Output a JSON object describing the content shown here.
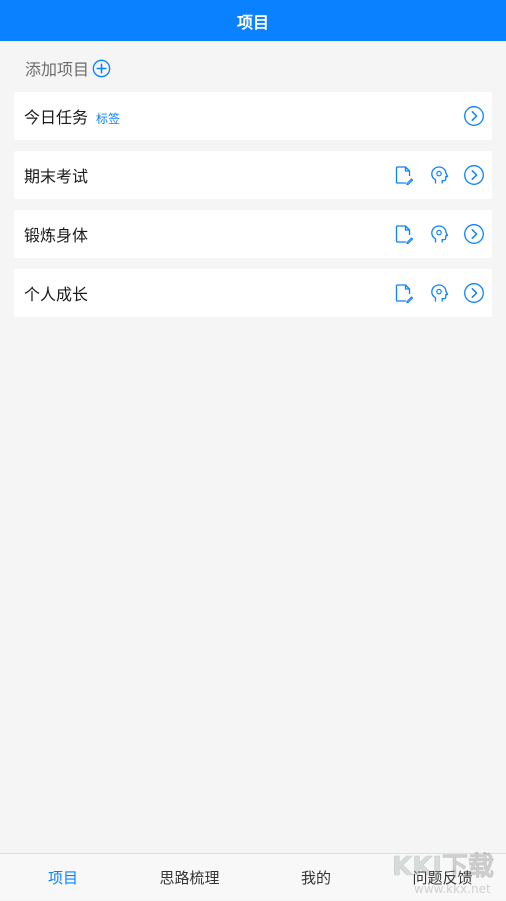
{
  "header": {
    "title": "项目"
  },
  "add_project": {
    "label": "添加项目",
    "icon": "plus-circle-icon"
  },
  "projects": [
    {
      "name": "今日任务",
      "tag": "标签",
      "has_actions": false
    },
    {
      "name": "期末考试",
      "has_actions": true
    },
    {
      "name": "锻炼身体",
      "has_actions": true
    },
    {
      "name": "个人成长",
      "has_actions": true
    }
  ],
  "card_icons": {
    "edit": "edit-document-icon",
    "mind": "head-idea-icon",
    "arrow": "chevron-right-circle-icon"
  },
  "bottom_nav": {
    "items": [
      {
        "label": "项目",
        "active": true
      },
      {
        "label": "思路梳理",
        "active": false
      },
      {
        "label": "我的",
        "active": false
      },
      {
        "label": "问题反馈",
        "active": false
      }
    ]
  },
  "watermark": {
    "text": "KKI下载",
    "url_text": "www.kkx.net"
  },
  "colors": {
    "accent": "#0a82ff",
    "background": "#f5f5f5",
    "text": "#1a1a1a",
    "muted": "#6b6b6b"
  }
}
